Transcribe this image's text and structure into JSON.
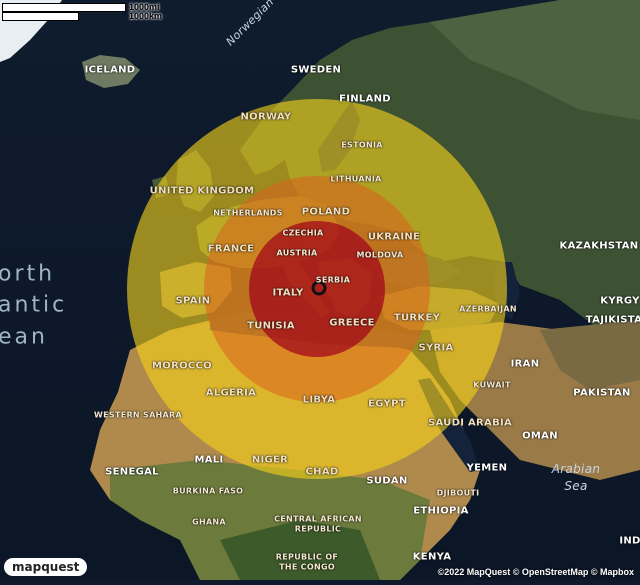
{
  "colors": {
    "ring_outer": "#f5d21a",
    "ring_middle": "#d9611e",
    "ring_inner": "#a0001a",
    "epicenter": "#111111"
  },
  "scale": {
    "miles_label": "1000mi",
    "km_label": "1000km"
  },
  "countries": [
    {
      "id": "iceland",
      "name": "ICELAND"
    },
    {
      "id": "sweden",
      "name": "SWEDEN"
    },
    {
      "id": "norway",
      "name": "NORWAY"
    },
    {
      "id": "finland",
      "name": "FINLAND"
    },
    {
      "id": "estonia",
      "name": "ESTONIA"
    },
    {
      "id": "lithuania",
      "name": "LITHUANIA"
    },
    {
      "id": "united-kingdom",
      "name": "UNITED KINGDOM"
    },
    {
      "id": "netherlands",
      "name": "NETHERLANDS"
    },
    {
      "id": "poland",
      "name": "POLAND"
    },
    {
      "id": "czechia",
      "name": "CZECHIA"
    },
    {
      "id": "ukraine",
      "name": "UKRAINE"
    },
    {
      "id": "france",
      "name": "FRANCE"
    },
    {
      "id": "austria",
      "name": "AUSTRIA"
    },
    {
      "id": "moldova",
      "name": "MOLDOVA"
    },
    {
      "id": "kazakhstan",
      "name": "KAZAKHSTAN"
    },
    {
      "id": "serbia",
      "name": "SERBIA"
    },
    {
      "id": "italy",
      "name": "ITALY"
    },
    {
      "id": "spain",
      "name": "SPAIN"
    },
    {
      "id": "kyrgyz",
      "name": "KYRGY"
    },
    {
      "id": "tajikistan",
      "name": "TAJIKISTA"
    },
    {
      "id": "greece",
      "name": "GREECE"
    },
    {
      "id": "turkey",
      "name": "TURKEY"
    },
    {
      "id": "azerbaijan",
      "name": "AZERBAIJAN"
    },
    {
      "id": "tunisia",
      "name": "TUNISIA"
    },
    {
      "id": "syria",
      "name": "SYRIA"
    },
    {
      "id": "morocco",
      "name": "MOROCCO"
    },
    {
      "id": "iran",
      "name": "IRAN"
    },
    {
      "id": "kuwait",
      "name": "KUWAIT"
    },
    {
      "id": "algeria",
      "name": "ALGERIA"
    },
    {
      "id": "libya",
      "name": "LIBYA"
    },
    {
      "id": "egypt",
      "name": "EGYPT"
    },
    {
      "id": "pakistan",
      "name": "PAKISTAN"
    },
    {
      "id": "western-sahara",
      "name": "WESTERN SAHARA"
    },
    {
      "id": "saudi-arabia",
      "name": "SAUDI ARABIA"
    },
    {
      "id": "oman",
      "name": "OMAN"
    },
    {
      "id": "mali",
      "name": "MALI"
    },
    {
      "id": "niger",
      "name": "NIGER"
    },
    {
      "id": "chad",
      "name": "CHAD"
    },
    {
      "id": "yemen",
      "name": "YEMEN"
    },
    {
      "id": "senegal",
      "name": "SENEGAL"
    },
    {
      "id": "sudan",
      "name": "SUDAN"
    },
    {
      "id": "burkina-faso",
      "name": "BURKINA FASO"
    },
    {
      "id": "djibouti",
      "name": "DJIBOUTI"
    },
    {
      "id": "ethiopia",
      "name": "ETHIOPIA"
    },
    {
      "id": "ghana",
      "name": "GHANA"
    },
    {
      "id": "car-1",
      "name": "CENTRAL AFRICAN"
    },
    {
      "id": "car-2",
      "name": "REPUBLIC"
    },
    {
      "id": "congo-1",
      "name": "REPUBLIC OF"
    },
    {
      "id": "congo-2",
      "name": "THE CONGO"
    },
    {
      "id": "kenya",
      "name": "KENYA"
    },
    {
      "id": "ind",
      "name": "IND"
    }
  ],
  "seas": {
    "norwegian": "Norwegian",
    "arabian_1": "Arabian",
    "arabian_2": "Sea",
    "atlantic_1": "orth",
    "atlantic_2": "antic",
    "atlantic_3": "ean"
  },
  "logo": "mapquest",
  "attribution": "©2022 MapQuest © OpenStreetMap © Mapbox"
}
